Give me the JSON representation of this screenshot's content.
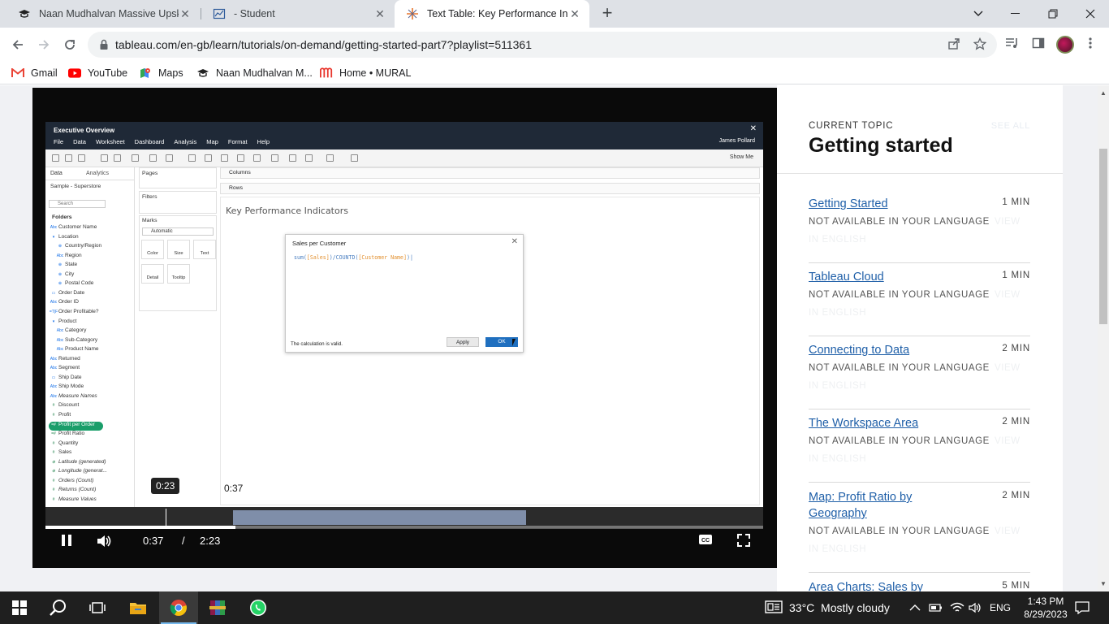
{
  "browser": {
    "tabs": [
      {
        "title": "Naan Mudhalvan Massive Upskilli",
        "active": false
      },
      {
        "title": "- Student",
        "active": false
      },
      {
        "title": "Text Table: Key Performance Indic",
        "active": true
      }
    ],
    "new_tab_label": "+",
    "url": "tableau.com/en-gb/learn/tutorials/on-demand/getting-started-part7?playlist=511361",
    "bookmarks": [
      "Gmail",
      "YouTube",
      "Maps",
      "Naan Mudhalvan M...",
      "Home • MURAL"
    ]
  },
  "video": {
    "app_title": "Executive Overview",
    "menu": [
      "File",
      "Data",
      "Worksheet",
      "Dashboard",
      "Analysis",
      "Map",
      "Format",
      "Help"
    ],
    "user": "James Pollard",
    "show_me": "Show Me",
    "data_tab": "Data",
    "analytics_tab": "Analytics",
    "datasource": "Sample - Superstore",
    "search_placeholder": "Search",
    "folders_label": "Folders",
    "fields": [
      {
        "name": "Customer Name",
        "indent": 0,
        "kind": "Abc",
        "type": "dim"
      },
      {
        "name": "Location",
        "indent": 0,
        "kind": "▾",
        "type": "dim"
      },
      {
        "name": "Country/Region",
        "indent": 1,
        "kind": "⊕",
        "type": "dim"
      },
      {
        "name": "Region",
        "indent": 1,
        "kind": "Abc",
        "type": "dim"
      },
      {
        "name": "State",
        "indent": 1,
        "kind": "⊕",
        "type": "dim"
      },
      {
        "name": "City",
        "indent": 1,
        "kind": "⊕",
        "type": "dim"
      },
      {
        "name": "Postal Code",
        "indent": 1,
        "kind": "⊕",
        "type": "dim"
      },
      {
        "name": "Order Date",
        "indent": 0,
        "kind": "▭",
        "type": "dim"
      },
      {
        "name": "Order ID",
        "indent": 0,
        "kind": "Abc",
        "type": "dim"
      },
      {
        "name": "Order Profitable?",
        "indent": 0,
        "kind": "=T|F",
        "type": "dim"
      },
      {
        "name": "Product",
        "indent": 0,
        "kind": "▾",
        "type": "dim"
      },
      {
        "name": "Category",
        "indent": 1,
        "kind": "Abc",
        "type": "dim"
      },
      {
        "name": "Sub-Category",
        "indent": 1,
        "kind": "Abc",
        "type": "dim"
      },
      {
        "name": "Product Name",
        "indent": 1,
        "kind": "Abc",
        "type": "dim"
      },
      {
        "name": "Returned",
        "indent": 0,
        "kind": "Abc",
        "type": "dim"
      },
      {
        "name": "Segment",
        "indent": 0,
        "kind": "Abc",
        "type": "dim"
      },
      {
        "name": "Ship Date",
        "indent": 0,
        "kind": "▭",
        "type": "dim"
      },
      {
        "name": "Ship Mode",
        "indent": 0,
        "kind": "Abc",
        "type": "dim"
      },
      {
        "name": "Measure Names",
        "indent": 0,
        "kind": "Abc",
        "type": "dim",
        "italic": true
      },
      {
        "name": "Discount",
        "indent": 0,
        "kind": "#",
        "type": "mea"
      },
      {
        "name": "Profit",
        "indent": 0,
        "kind": "#",
        "type": "mea"
      },
      {
        "name": "Profit per Order",
        "indent": 0,
        "kind": "=#",
        "type": "mea",
        "highlight": true
      },
      {
        "name": "Profit Ratio",
        "indent": 0,
        "kind": "=#",
        "type": "mea"
      },
      {
        "name": "Quantity",
        "indent": 0,
        "kind": "#",
        "type": "mea"
      },
      {
        "name": "Sales",
        "indent": 0,
        "kind": "#",
        "type": "mea"
      },
      {
        "name": "Latitude (generated)",
        "indent": 0,
        "kind": "⊕",
        "type": "mea",
        "italic": true
      },
      {
        "name": "Longitude (generat...",
        "indent": 0,
        "kind": "⊕",
        "type": "mea",
        "italic": true
      },
      {
        "name": "Orders (Count)",
        "indent": 0,
        "kind": "#",
        "type": "mea",
        "italic": true
      },
      {
        "name": "Returns (Count)",
        "indent": 0,
        "kind": "#",
        "type": "mea",
        "italic": true
      },
      {
        "name": "Measure Values",
        "indent": 0,
        "kind": "#",
        "type": "mea",
        "italic": true
      }
    ],
    "pages_label": "Pages",
    "filters_label": "Filters",
    "marks_label": "Marks",
    "marks_type": "Automatic",
    "mark_buttons": [
      "Color",
      "Size",
      "Text",
      "Detail",
      "Tooltip"
    ],
    "columns_label": "Columns",
    "rows_label": "Rows",
    "sheet_title": "Key Performance Indicators",
    "dialog": {
      "title": "Sales per Customer",
      "formula_fn1": "sum(",
      "formula_field1": "[Sales]",
      "formula_mid": ")/COUNTD(",
      "formula_field2": "[Customer Name]",
      "formula_end": ")",
      "status": "The calculation is valid.",
      "apply": "Apply",
      "ok": "OK"
    },
    "hover_time": "0:23",
    "preview_time": "0:37",
    "current_time": "0:37",
    "separator": "/",
    "duration": "2:23",
    "progress_fraction": 0.265
  },
  "sidebar": {
    "current_label": "CURRENT TOPIC",
    "current_title": "Getting started",
    "see_all": "SEE ALL",
    "topics": [
      {
        "title": "Getting Started",
        "duration": "1 MIN",
        "note": "NOT AVAILABLE IN YOUR LANGUAGE",
        "note2": "VIEW IN ENGLISH"
      },
      {
        "title": "Tableau Cloud",
        "duration": "1 MIN",
        "note": "NOT AVAILABLE IN YOUR LANGUAGE",
        "note2": "VIEW IN ENGLISH"
      },
      {
        "title": "Connecting to Data",
        "duration": "2 MIN",
        "note": "NOT AVAILABLE IN YOUR LANGUAGE",
        "note2": "VIEW IN ENGLISH"
      },
      {
        "title": "The Workspace Area",
        "duration": "2 MIN",
        "note": "NOT AVAILABLE IN YOUR LANGUAGE",
        "note2": "VIEW IN ENGLISH"
      },
      {
        "title": "Map: Profit Ratio by Geography",
        "duration": "2 MIN",
        "note": "NOT AVAILABLE IN YOUR LANGUAGE",
        "note2": "VIEW IN ENGLISH"
      },
      {
        "title": "Area Charts: Sales by",
        "duration": "5 MIN",
        "note": "",
        "note2": ""
      }
    ]
  },
  "taskbar": {
    "weather": "33°C  Mostly cloudy",
    "lang": "ENG",
    "time": "1:43 PM",
    "date": "8/29/2023"
  }
}
